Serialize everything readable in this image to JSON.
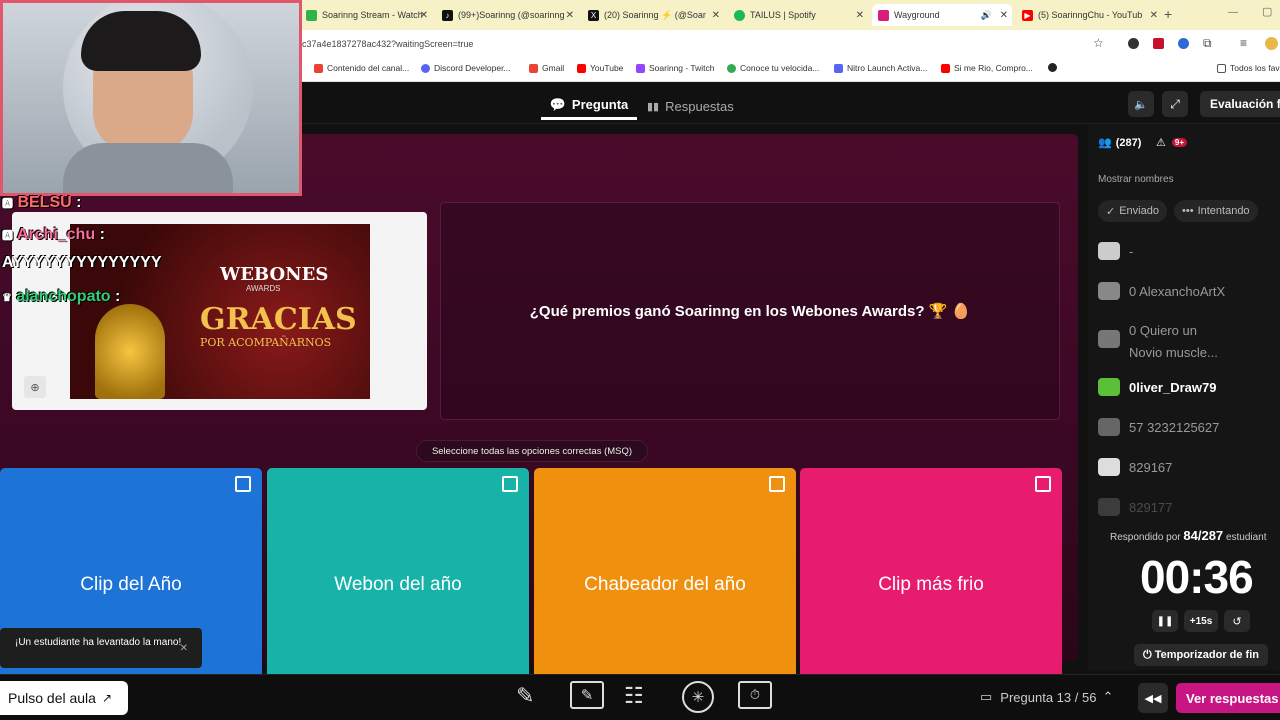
{
  "browser": {
    "tabs": [
      {
        "title": "Soarinng Stream - Watch",
        "color": "#2fb34a"
      },
      {
        "title": "(99+)Soarinng (@soarinng",
        "color": "#111111"
      },
      {
        "title": "(20) Soarinng ⚡ (@Soar",
        "color": "#111111"
      },
      {
        "title": "TAILUS | Spotify",
        "color": "#1db954"
      },
      {
        "title": "Wayground",
        "color": "#d61f7a"
      },
      {
        "title": "(5) SoarinngChu - YouTub",
        "color": "#ff0000"
      }
    ],
    "url": "c37a4e1837278ac432?waitingScreen=true",
    "bookmarks": [
      {
        "label": "Contenido del canal...",
        "color": "#ea4335"
      },
      {
        "label": "Discord Developer...",
        "color": "#5865f2"
      },
      {
        "label": "Gmail",
        "color": "#ea4335"
      },
      {
        "label": "YouTube",
        "color": "#ff0000"
      },
      {
        "label": "Soarinng - Twitch",
        "color": "#9146ff"
      },
      {
        "label": "Conoce tu velocida...",
        "color": "#34a853"
      },
      {
        "label": "Nitro Launch Activa...",
        "color": "#5865f2"
      },
      {
        "label": "Si me Rio, Compro...",
        "color": "#ff0000"
      }
    ],
    "bookmarks_folder": "Todos los fav"
  },
  "nav": {
    "tab_question": "Pregunta",
    "tab_answers": "Respuestas",
    "end_eval": "Evaluación fin"
  },
  "question": {
    "text": "¿Qué premios ganó Soarinng en los Webones Awards? 🏆 🥚",
    "image_title": "WEBONES",
    "image_subtitle": "AWARDS",
    "image_line1": "GRACIAS",
    "image_line2": "POR ACOMPAÑARNOS",
    "msq_label": "Seleccione todas las opciones correctas (MSQ)"
  },
  "options": [
    {
      "label": "Clip del Año",
      "color": "#1e73d6"
    },
    {
      "label": "Webon del año",
      "color": "#17b3a8"
    },
    {
      "label": "Chabeador del año",
      "color": "#f0900f"
    },
    {
      "label": "Clip más frio",
      "color": "#e81c6f"
    }
  ],
  "sidebar": {
    "participants": "(287)",
    "alerts": "9+",
    "show_names": "Mostrar nombres",
    "filter_sent": "Enviado",
    "filter_trying": "Intentando",
    "students": [
      {
        "name": "-",
        "highlight": false
      },
      {
        "name": "0 AlexanchoArtX",
        "highlight": false
      },
      {
        "name": "0 Quiero un",
        "name2": "Novio muscle...",
        "highlight": false
      },
      {
        "name": "0liver_Draw79",
        "highlight": true
      },
      {
        "name": "57 3232125627",
        "highlight": false
      },
      {
        "name": "829167",
        "highlight": false
      },
      {
        "name": "829177",
        "highlight": false
      }
    ],
    "answered_prefix": "Respondido por",
    "answered_count": "84/287",
    "answered_suffix": "estudiant",
    "timer": "00:36",
    "add_time": "+15s",
    "end_timer": "Temporizador de fin"
  },
  "bottombar": {
    "pulse": "Pulso del aula",
    "question_counter": "Pregunta 13 / 56",
    "see_answers": "Ver respuestas"
  },
  "stream_overlay": {
    "chat": [
      {
        "user": "BELSU",
        "text": ":",
        "color": "#ff6b6b"
      },
      {
        "user": "Archi_chu",
        "text": ":",
        "color": "#ff6b9a"
      },
      {
        "user": "",
        "text": "AYYYYYYYYYYYYYY",
        "color": "#ffffff"
      },
      {
        "user": "alanchopato",
        "text": ":",
        "color": "#33cc77"
      }
    ],
    "toast": "¡Un estudiante ha levantado la mano!"
  }
}
